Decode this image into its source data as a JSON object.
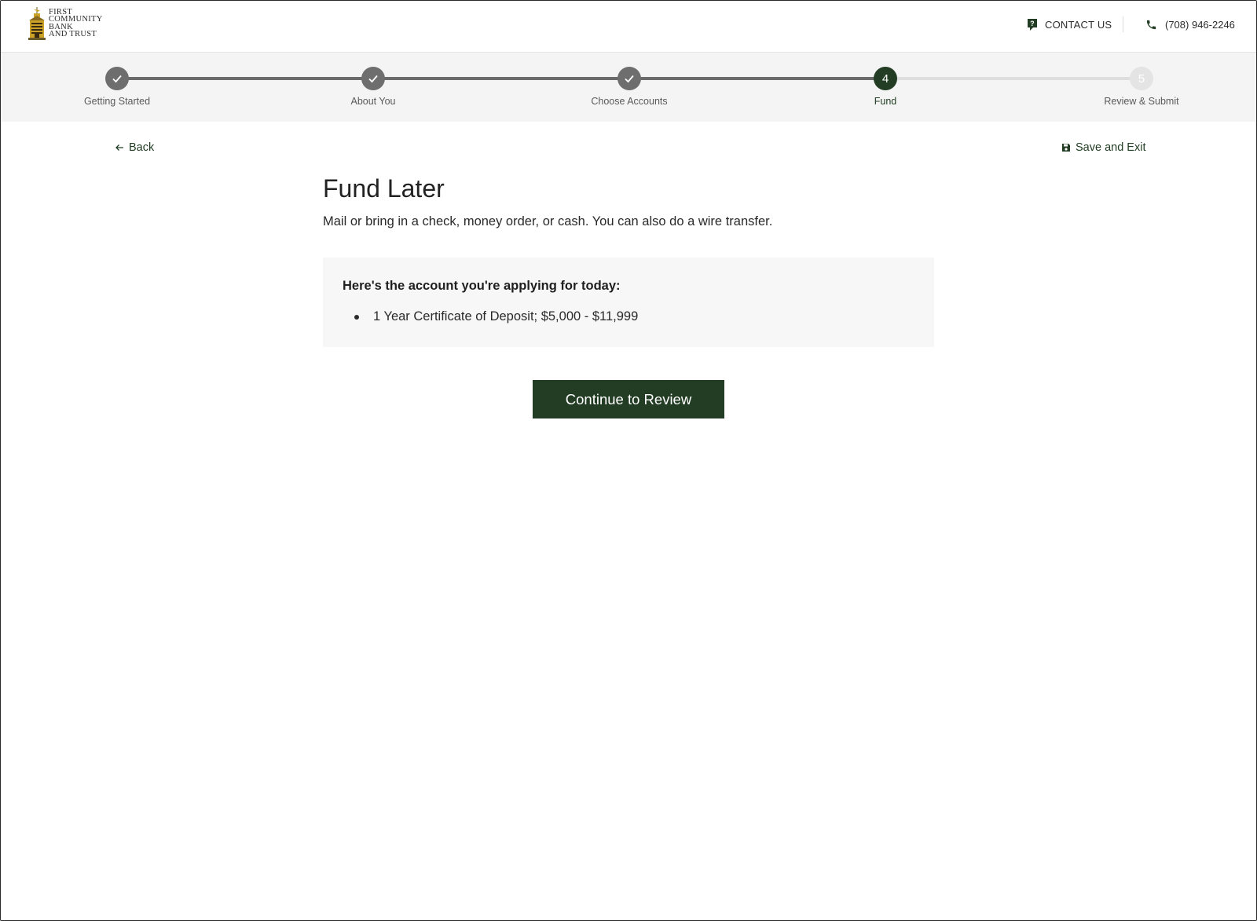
{
  "header": {
    "logo_lines": [
      "First",
      "Community",
      "Bank",
      "and Trust"
    ],
    "contact_label": "CONTACT US",
    "phone": "(708) 946-2246"
  },
  "stepper": {
    "steps": [
      {
        "label": "Getting Started",
        "number": "1",
        "state": "complete"
      },
      {
        "label": "About You",
        "number": "2",
        "state": "complete"
      },
      {
        "label": "Choose Accounts",
        "number": "3",
        "state": "complete"
      },
      {
        "label": "Fund",
        "number": "4",
        "state": "current"
      },
      {
        "label": "Review & Submit",
        "number": "5",
        "state": "upcoming"
      }
    ]
  },
  "nav": {
    "back_label": "Back",
    "save_exit_label": "Save and Exit"
  },
  "main": {
    "title": "Fund Later",
    "subtitle": "Mail or bring in a check, money order, or cash. You can also do a wire transfer.",
    "summary_heading": "Here's the account you're applying for today:",
    "accounts": [
      "1 Year Certificate of Deposit; $5,000 - $11,999"
    ],
    "continue_label": "Continue to Review"
  },
  "colors": {
    "brand_green": "#223d24",
    "step_complete": "#6e6e6e",
    "step_upcoming": "#e4e4e4",
    "summary_bg": "#f7f7f7"
  }
}
